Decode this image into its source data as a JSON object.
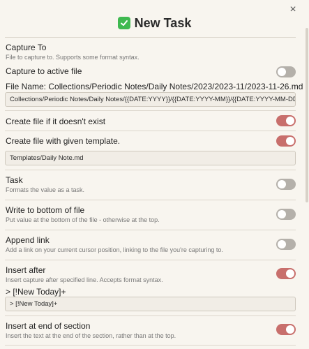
{
  "modal": {
    "title": "New Task",
    "title_icon": "check-mark-emoji-icon",
    "close_label": "×"
  },
  "settings": {
    "capture_to": {
      "name": "Capture To",
      "desc": "File to capture to. Supports some format syntax."
    },
    "capture_active": {
      "name": "Capture to active file",
      "enabled": false
    },
    "file_name": {
      "label": "File Name: Collections/Periodic Notes/Daily Notes/2023/2023-11/2023-11-26.md",
      "value": "Collections/Periodic Notes/Daily Notes/{{DATE:YYYY}}/{{DATE:YYYY-MM}}/{{DATE:YYYY-MM-DD}}."
    },
    "create_if_missing": {
      "name": "Create file if it doesn't exist",
      "enabled": true
    },
    "create_with_template": {
      "name": "Create file with given template.",
      "enabled": true,
      "template_value": "Templates/Daily Note.md"
    },
    "task": {
      "name": "Task",
      "desc": "Formats the value as a task.",
      "enabled": false
    },
    "write_bottom": {
      "name": "Write to bottom of file",
      "desc": "Put value at the bottom of the file - otherwise at the top.",
      "enabled": false
    },
    "append_link": {
      "name": "Append link",
      "desc": "Add a link on your current cursor position, linking to the file you're capturing to.",
      "enabled": false
    },
    "insert_after": {
      "name": "Insert after",
      "desc": "Insert capture after specified line. Accepts format syntax.",
      "enabled": true,
      "preview": "> [!New Today]+",
      "value": "> [!New Today]+"
    },
    "insert_end_section": {
      "name": "Insert at end of section",
      "desc": "Insert the text at the end of the section, rather than at the top.",
      "enabled": true
    }
  },
  "colors": {
    "toggle_on": "#c86f6c",
    "toggle_off": "#b4b0aa",
    "background": "#f8f5ef"
  }
}
